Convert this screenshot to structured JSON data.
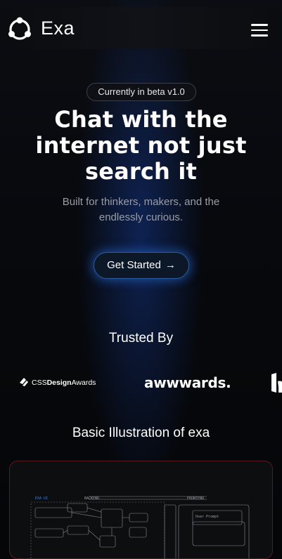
{
  "header": {
    "brand": "Exa",
    "menu_icon": "hamburger-menu-icon",
    "logo_icon": "exa-logo-icon"
  },
  "hero": {
    "badge": "Currently in beta v1.0",
    "title_lines": [
      "Chat with the",
      "internet not just",
      "search it"
    ],
    "subtitle_lines": [
      "Built for thinkers, makers, and the",
      "endlessly curious."
    ],
    "cta_label": "Get Started",
    "cta_arrow": "→"
  },
  "trusted": {
    "heading": "Trusted By",
    "logos": {
      "css_design_awards_part1": "CSS",
      "css_design_awards_part2": "Design",
      "css_design_awards_part3": "Awards",
      "awwwards": "awwwards."
    }
  },
  "illustration": {
    "heading": "Basic Illustration of exa",
    "labels": {
      "top_left": "EXA UI",
      "top_middle": "BACKEND",
      "top_right": "FRONTEND",
      "box_prompt": "User Prompt"
    }
  },
  "colors": {
    "accent_glow": "#2d6ee0",
    "card_border": "#5a1a22",
    "background": "#050608"
  }
}
